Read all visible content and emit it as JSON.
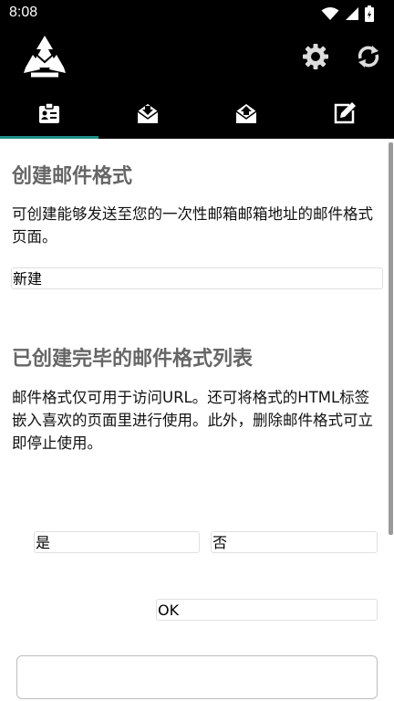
{
  "status_bar": {
    "time": "8:08"
  },
  "section_create": {
    "title": "创建邮件格式",
    "description": "可创建能够发送至您的一次性邮箱邮箱地址的邮件格式页面。",
    "new_button": "新建"
  },
  "section_list": {
    "title": "已创建完毕的邮件格式列表",
    "description": "邮件格式仅可用于访问URL。还可将格式的HTML标签嵌入喜欢的页面里进行使用。此外，删除邮件格式可立即停止使用。"
  },
  "dialog": {
    "yes_label": "是",
    "no_label": "否",
    "ok_label": "OK"
  },
  "colors": {
    "tab_indicator": "#1f8e86",
    "heading": "#666666",
    "bar": "#000000"
  }
}
